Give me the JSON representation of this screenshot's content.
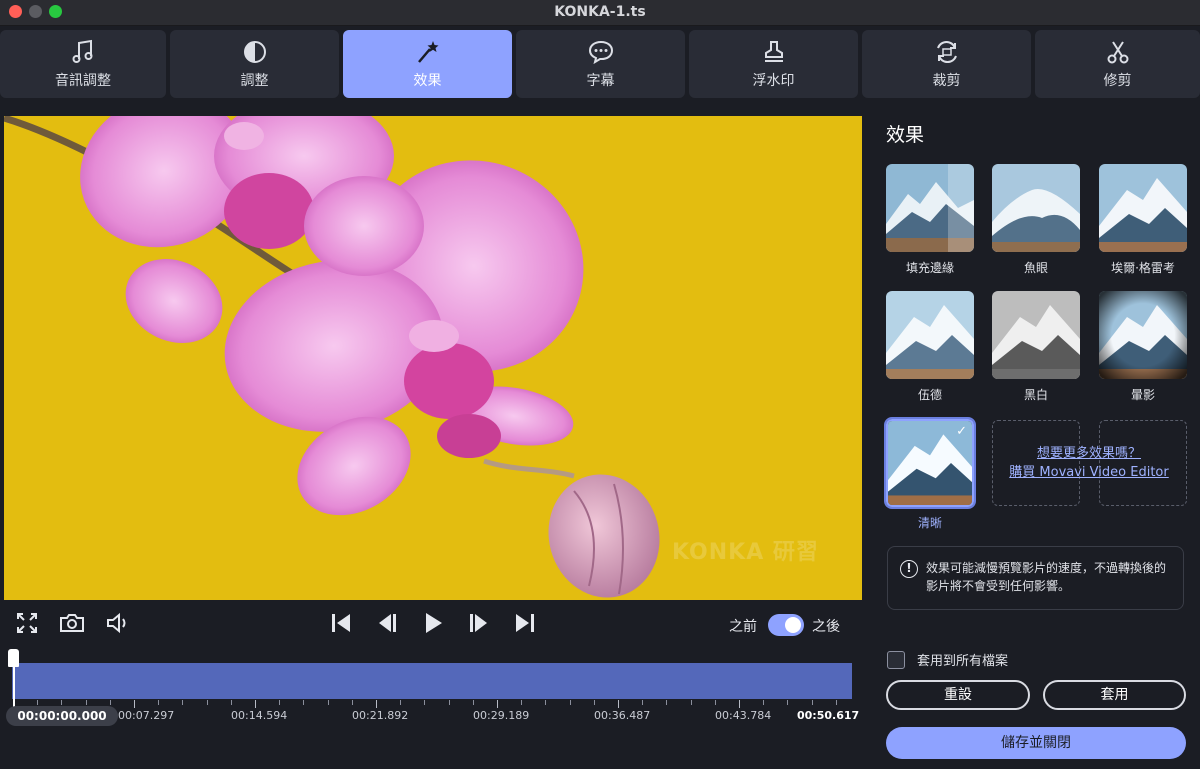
{
  "window": {
    "title": "KONKA-1.ts"
  },
  "tabs": [
    {
      "label": "音訊調整",
      "icon": "music-note-icon"
    },
    {
      "label": "調整",
      "icon": "contrast-icon"
    },
    {
      "label": "效果",
      "icon": "magic-wand-icon",
      "active": true
    },
    {
      "label": "字幕",
      "icon": "speech-bubble-icon"
    },
    {
      "label": "浮水印",
      "icon": "stamp-icon"
    },
    {
      "label": "裁剪",
      "icon": "crop-rotate-icon"
    },
    {
      "label": "修剪",
      "icon": "scissors-icon"
    }
  ],
  "preview": {
    "watermark": "KONKA 研習"
  },
  "player": {
    "before_label": "之前",
    "after_label": "之後",
    "toggle_on": true
  },
  "timeline": {
    "current": "00:00:00.000",
    "labels": [
      "00:07.297",
      "00:14.594",
      "00:21.892",
      "00:29.189",
      "00:36.487",
      "00:43.784",
      "00:50.617"
    ]
  },
  "effects_panel": {
    "title": "效果",
    "effects": [
      {
        "label": "填充邊緣",
        "selected": false
      },
      {
        "label": "魚眼",
        "selected": false
      },
      {
        "label": "埃爾·格雷考",
        "selected": false
      },
      {
        "label": "伍德",
        "selected": false
      },
      {
        "label": "黑白",
        "selected": false
      },
      {
        "label": "暈影",
        "selected": false
      },
      {
        "label": "清晰",
        "selected": true
      }
    ],
    "more_line1": "想要更多效果嗎？",
    "more_line2": "購買 Movavi Video Editor",
    "info_text": "效果可能減慢預覽影片的速度，不過轉換後的影片將不會受到任何影響。",
    "apply_all_label": "套用到所有檔案",
    "reset_label": "重設",
    "apply_label": "套用",
    "save_close_label": "儲存並關閉"
  },
  "colors": {
    "accent": "#8ea2ff",
    "timeline": "#5468ba",
    "preview_bg": "#e3bd10",
    "orchid": "#e07fcf"
  }
}
